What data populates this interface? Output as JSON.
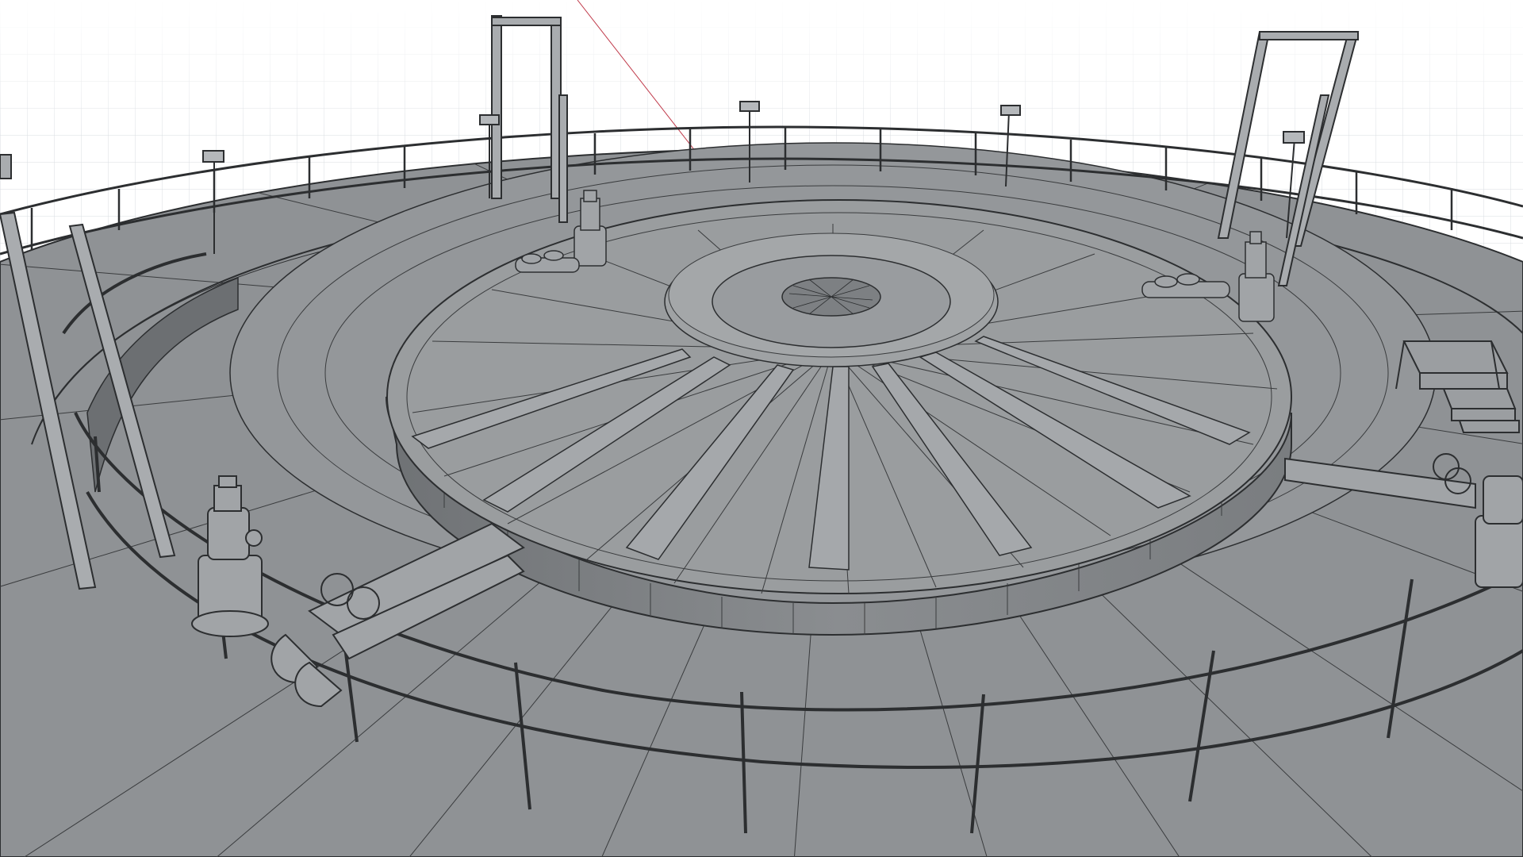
{
  "viewport": {
    "mode": "wireframe-shaded",
    "background_color": "#ffffff",
    "grid_color": "#cfd3d8",
    "deck_color": "#8f9295",
    "edge_color": "#2c2e30",
    "axis_color": "#c03a4a"
  },
  "scene": {
    "object": "circular-tank-roof",
    "components": [
      "floating-roof-dome",
      "center-manhole",
      "perimeter-handrail",
      "pressure-relief-valves",
      "valve-manifolds",
      "lamp-posts",
      "gantry-frames",
      "access-stair"
    ]
  }
}
